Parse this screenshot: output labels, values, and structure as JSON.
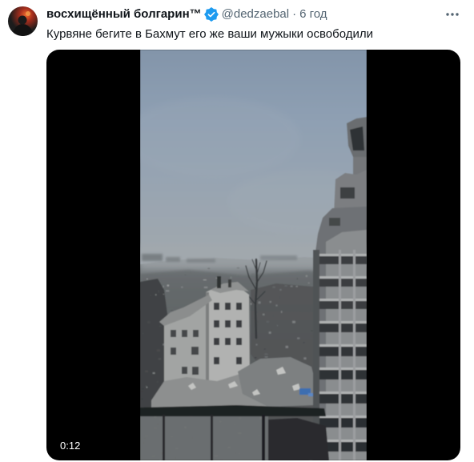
{
  "tweet": {
    "author": {
      "display_name": "восхищённый болгарин™",
      "handle": "@dedzaebal"
    },
    "separator": "·",
    "timestamp": "6 год",
    "text": "Курвяне бегите в Бахмут его же ваши мужыки освободили",
    "media": {
      "duration": "0:12"
    }
  },
  "icons": {
    "verified": "verified-badge-icon",
    "more": "more-horizontal-icon"
  },
  "colors": {
    "primary_text": "#0f1419",
    "secondary_text": "#536471",
    "verified_badge": "#1d9bf0",
    "media_background": "#000000",
    "duration_badge_background": "rgba(0,0,0,0.77)"
  }
}
